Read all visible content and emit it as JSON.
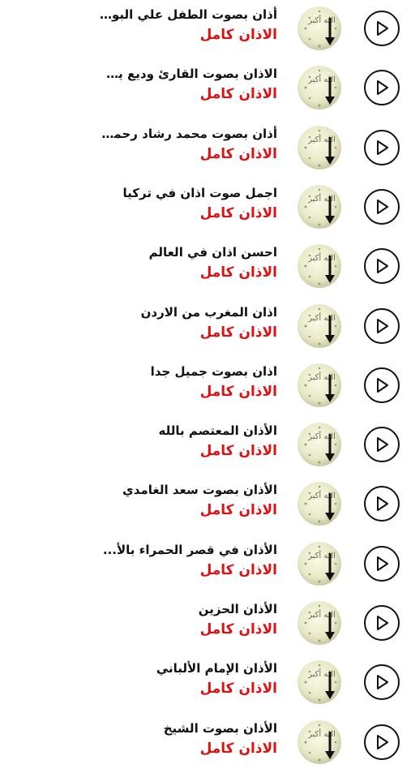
{
  "subtitle": "الاذان كامل",
  "colors": {
    "subtitle": "#e01010",
    "title": "#111111"
  },
  "items": [
    {
      "title": "أذان بصوت الطفل علي البوا..."
    },
    {
      "title": "الاذان بصوت القارئ وديع يمنى"
    },
    {
      "title": "أذان بصوت محمد رشاد رحمه..."
    },
    {
      "title": "اجمل صوت اذان في تركيا"
    },
    {
      "title": "احسن اذان في العالم"
    },
    {
      "title": "اذان المغرب من الاردن"
    },
    {
      "title": "اذان بصوت جميل جدا"
    },
    {
      "title": "الأذان المعتصم بالله"
    },
    {
      "title": "الأذان بصوت سعد الغامدي"
    },
    {
      "title": "الأذان في قصر الحمراء بالأ..."
    },
    {
      "title": "الأذان الحزين"
    },
    {
      "title": "الأذان الإمام الألباني"
    },
    {
      "title": "الأذان بصوت الشيخ"
    }
  ]
}
